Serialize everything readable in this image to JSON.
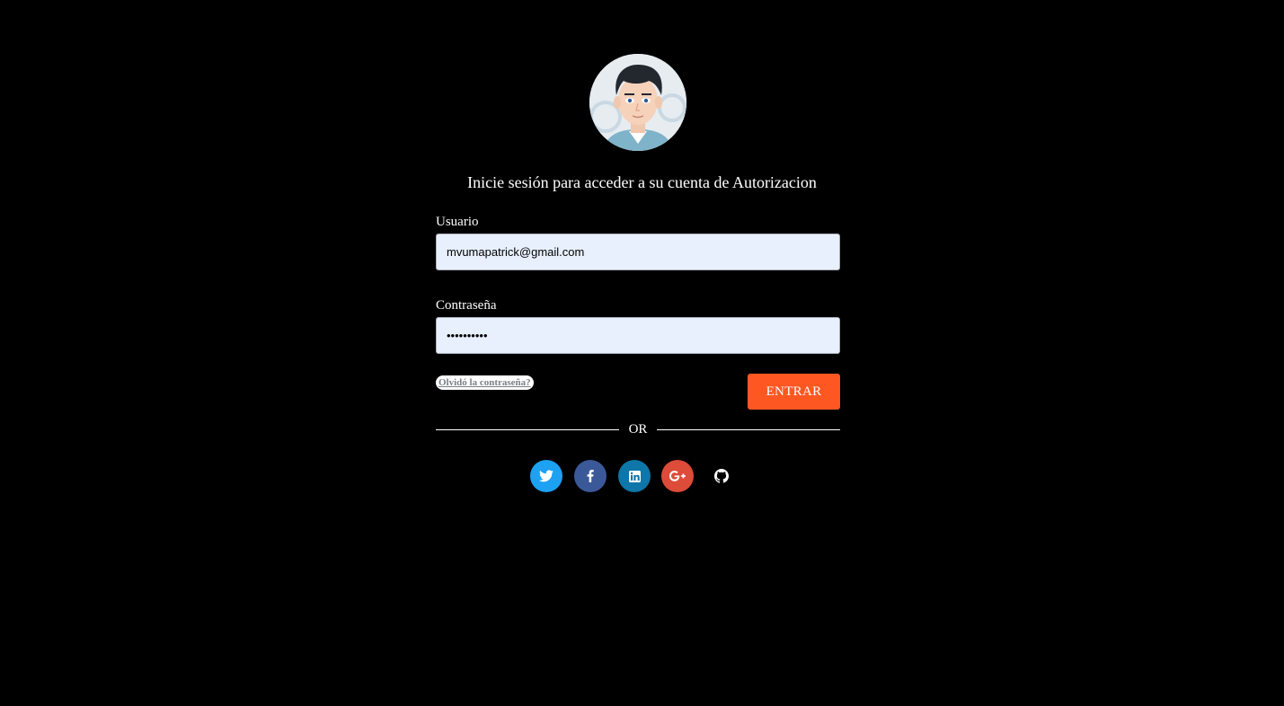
{
  "login": {
    "heading": "Inicie sesión para acceder a su cuenta de Autorizacion",
    "username_label": "Usuario",
    "username_value": "mvumapatrick@gmail.com",
    "password_label": "Contraseña",
    "password_value": "••••••••••",
    "forgot_label": "Olvidó la contraseña?",
    "submit_label": "ENTRAR",
    "divider_text": "OR"
  },
  "social": [
    {
      "name": "twitter",
      "icon": "twitter-icon",
      "color": "#1da1f2"
    },
    {
      "name": "facebook",
      "icon": "facebook-icon",
      "color": "#3b5998"
    },
    {
      "name": "linkedin",
      "icon": "linkedin-icon",
      "color": "#0e76a8"
    },
    {
      "name": "google-plus",
      "icon": "google-plus-icon",
      "color": "#dd4b39"
    },
    {
      "name": "github",
      "icon": "github-icon",
      "color": "#000000"
    }
  ],
  "colors": {
    "background": "#000000",
    "accent": "#ff5722",
    "input_background": "#e8f0fe"
  }
}
